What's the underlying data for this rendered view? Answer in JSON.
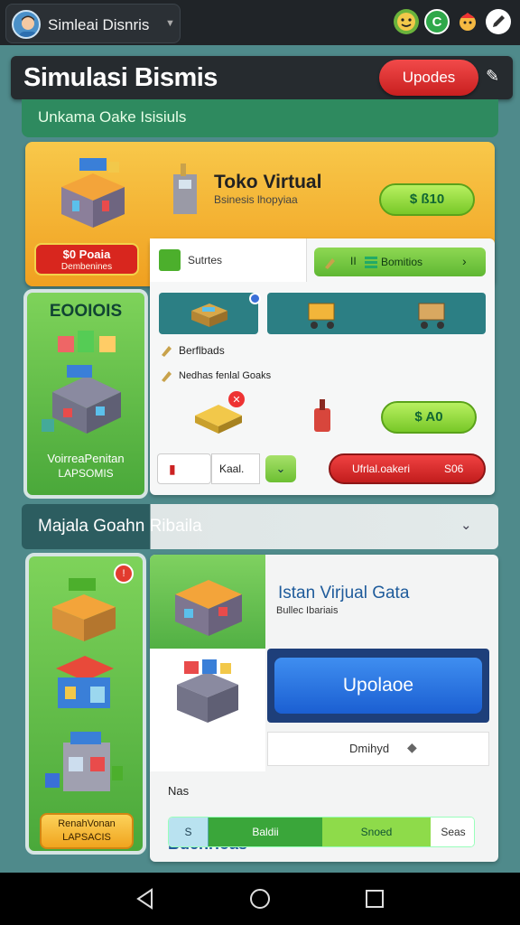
{
  "statusbar": {
    "profile_name": "Simleai Disnris",
    "icons": [
      "face-icon",
      "c-badge-icon",
      "character-icon",
      "edit-icon"
    ]
  },
  "header": {
    "title": "Simulasi Bismis",
    "updates_label": "Upodes",
    "subtitle": "Unkama Oake Isisiuls"
  },
  "shop_card": {
    "title": "Toko Virtual",
    "subtitle": "Bsinesis lhopyiaa",
    "price_label": "$ ß10",
    "badge_line1": "$0 Poaia",
    "badge_line2": "Dembenines"
  },
  "left_panel_1": {
    "title": "EOOIOIS",
    "caption1": "VoirreaPenitan",
    "caption2": "LAPSOMIS"
  },
  "work_panel": {
    "tab1_label": "Sutrtes",
    "tab2_label": "Bomitios",
    "row1_label": "Berflbads",
    "row2_label": "Nedhas fenlal Goaks",
    "price_label": "$ A0",
    "input_text": "Kaal.",
    "red_left": "Ufrlal.oakeri",
    "red_right": "S06"
  },
  "section": {
    "title": "Majala Goahn Ribaila"
  },
  "left_panel_2": {
    "btn_line1": "RenahVonan",
    "btn_line2": "LAPSACIS"
  },
  "bottom_panel": {
    "title": "Istan Virjual Gata",
    "subtitle": "Bullec Ibariais",
    "edit_label": "Bdenrioas",
    "primary_btn": "Upolaoe",
    "row_text": "Dmihyd",
    "nas_label": "Nas",
    "segments": [
      "S",
      "Baldii",
      "Snoed",
      "Seas"
    ]
  },
  "colors": {
    "accent_green": "#6cbf32",
    "accent_red": "#d8261e",
    "accent_orange": "#f0a020",
    "primary_blue": "#1b5fd2",
    "background": "#4f8a8b"
  }
}
